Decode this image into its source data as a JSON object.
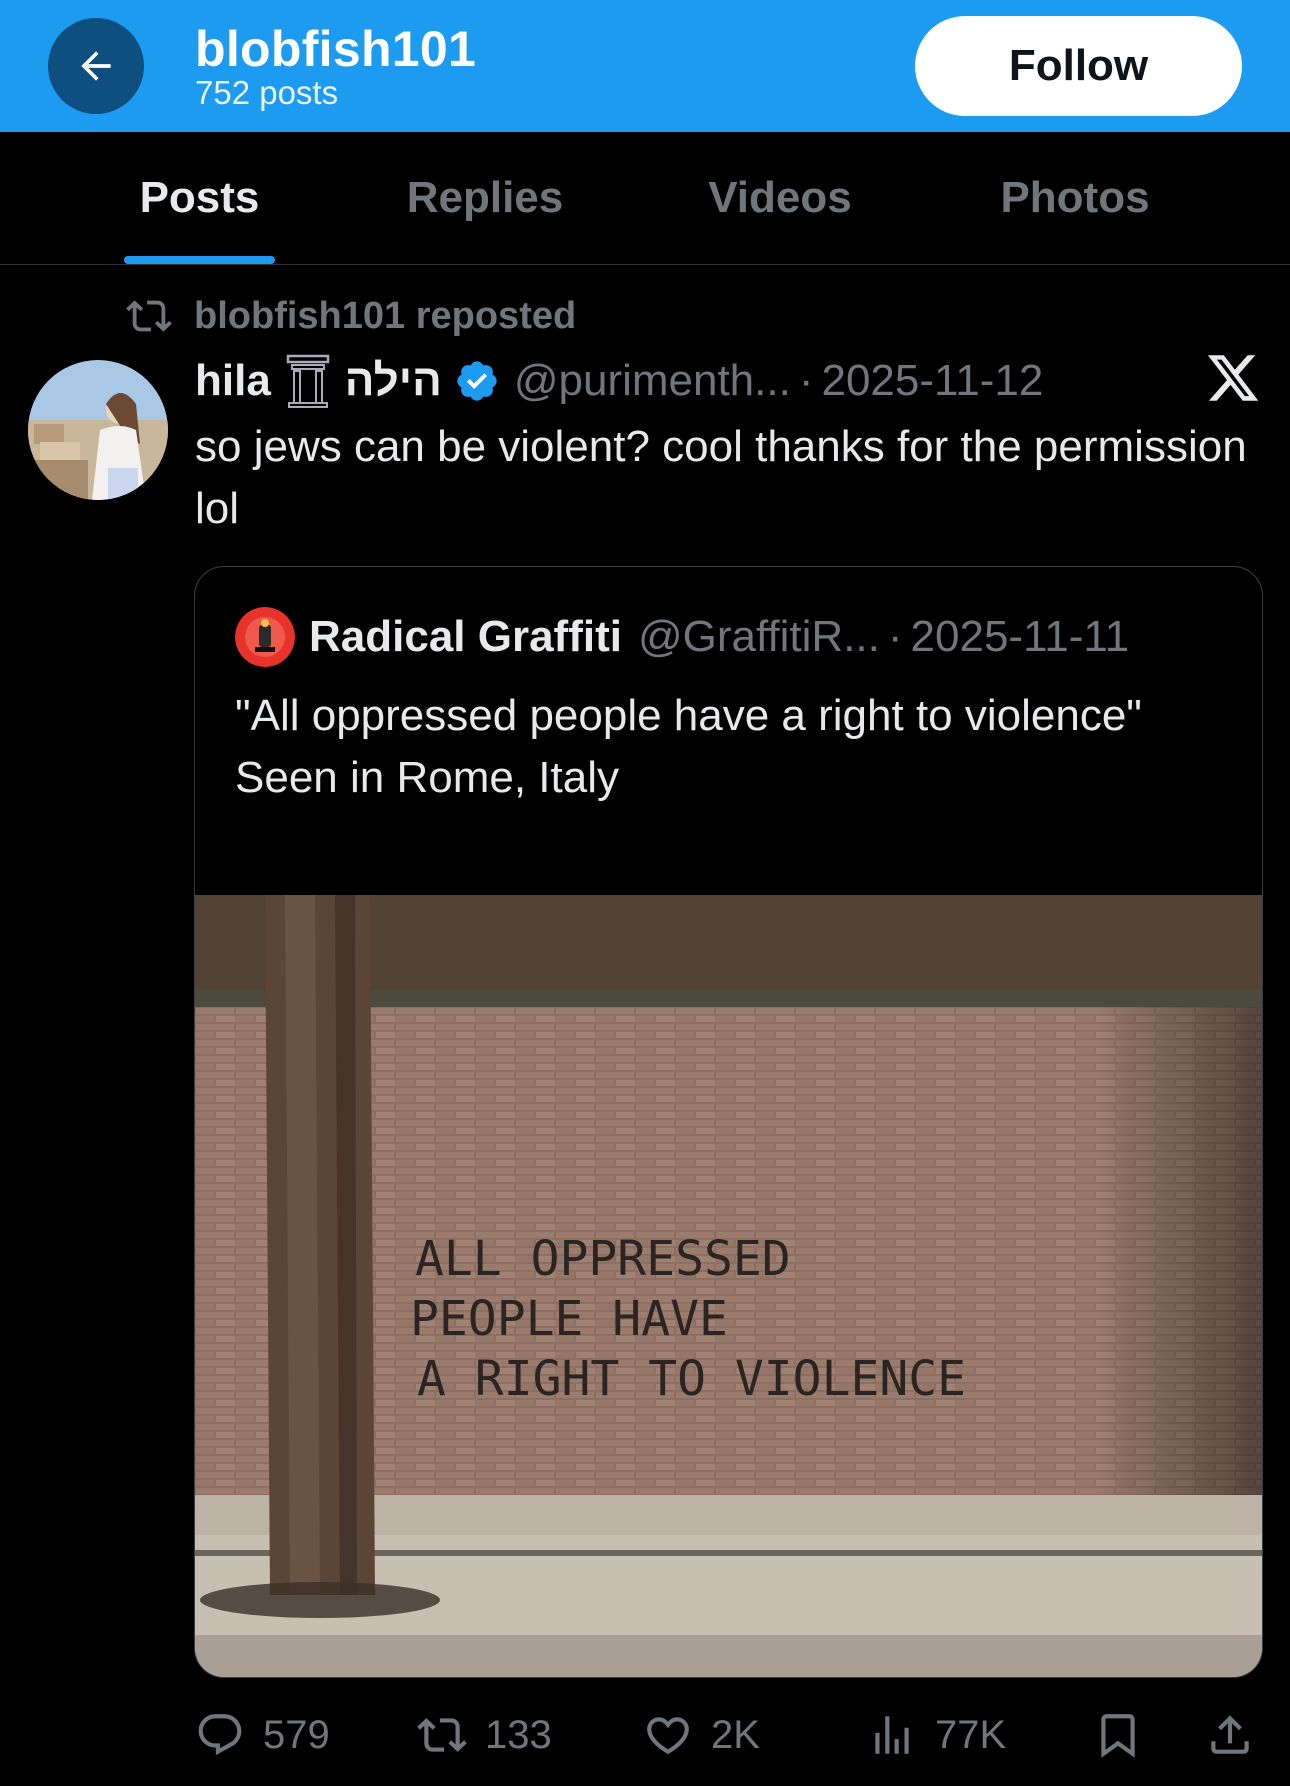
{
  "header": {
    "username": "blobfish101",
    "posts_count": "752 posts",
    "follow_label": "Follow"
  },
  "tabs": [
    {
      "label": "Posts",
      "active": true
    },
    {
      "label": "Replies",
      "active": false
    },
    {
      "label": "Videos",
      "active": false
    },
    {
      "label": "Photos",
      "active": false
    }
  ],
  "repost": {
    "text": "blobfish101 reposted"
  },
  "post": {
    "name": "hila",
    "hebrew_name": "הילה",
    "handle": "@purimenth...",
    "separator": "·",
    "date": "2025-11-12",
    "text": "so jews can be violent? cool thanks for the permission lol"
  },
  "quote": {
    "name": "Radical Graffiti",
    "handle": "@GraffitiR...",
    "separator": "·",
    "date": "2025-11-11",
    "text_lines": [
      "\"All oppressed people have a right to violence\"",
      "Seen in Rome, Italy"
    ],
    "graffiti_lines": [
      "ALL OPPRESSED",
      "PEOPLE HAVE",
      "A RIGHT TO VIOLENCE"
    ]
  },
  "actions": {
    "replies": "579",
    "reposts": "133",
    "likes": "2K",
    "views": "77K"
  },
  "colors": {
    "accent": "#1d9bf0",
    "background": "#000000",
    "muted": "#71767b",
    "text": "#e7e9ea"
  }
}
